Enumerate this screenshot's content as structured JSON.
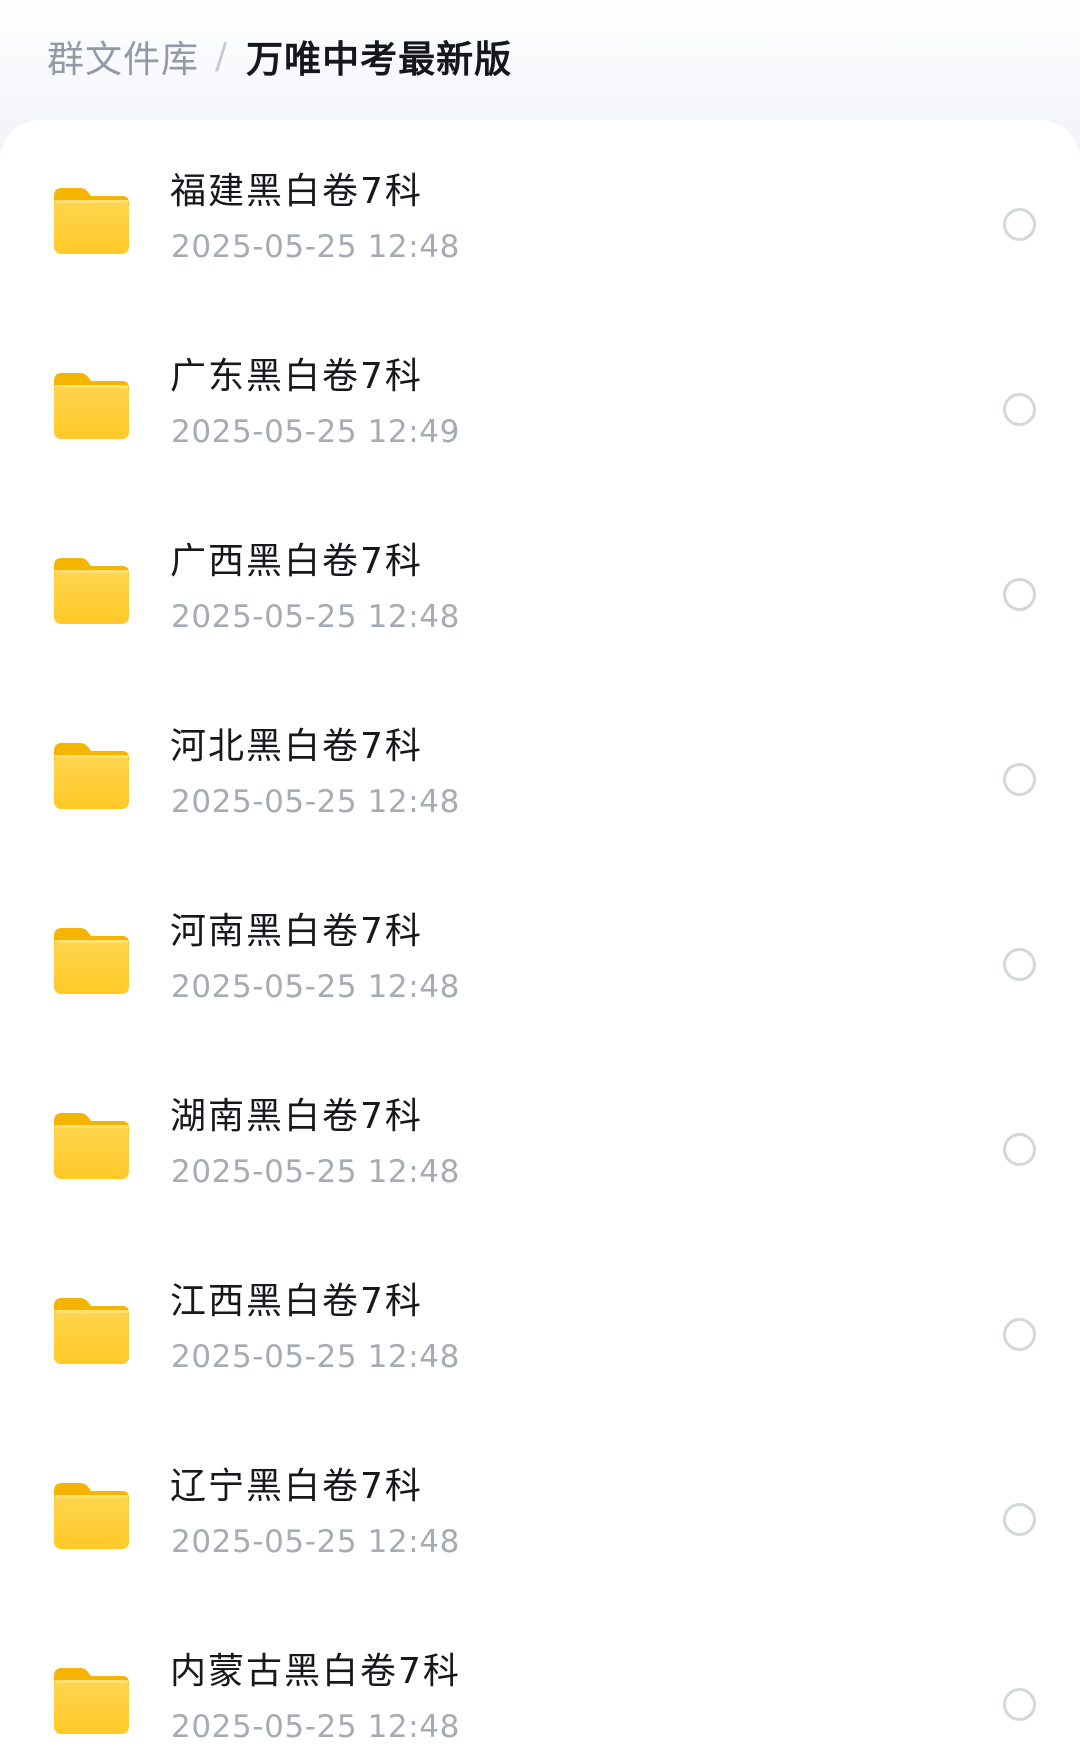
{
  "breadcrumb": {
    "parent": "群文件库",
    "separator": "/",
    "current": "万唯中考最新版"
  },
  "folder_icon": {
    "name": "folder-icon",
    "color_top": "#ffd54f",
    "color_bottom": "#ffc928",
    "color_back": "#f5b400"
  },
  "files": [
    {
      "name": "福建黑白卷7科",
      "time": "2025-05-25 12:48"
    },
    {
      "name": "广东黑白卷7科",
      "time": "2025-05-25 12:49"
    },
    {
      "name": "广西黑白卷7科",
      "time": "2025-05-25 12:48"
    },
    {
      "name": "河北黑白卷7科",
      "time": "2025-05-25 12:48"
    },
    {
      "name": "河南黑白卷7科",
      "time": "2025-05-25 12:48"
    },
    {
      "name": "湖南黑白卷7科",
      "time": "2025-05-25 12:48"
    },
    {
      "name": "江西黑白卷7科",
      "time": "2025-05-25 12:48"
    },
    {
      "name": "辽宁黑白卷7科",
      "time": "2025-05-25 12:48"
    },
    {
      "name": "内蒙古黑白卷7科",
      "time": "2025-05-25 12:48"
    }
  ]
}
